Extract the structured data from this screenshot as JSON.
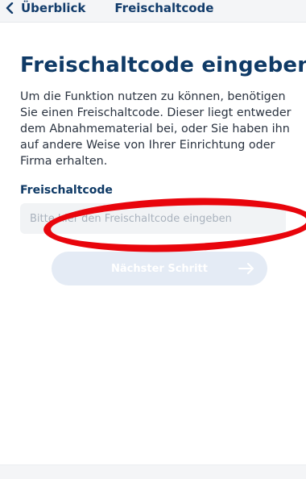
{
  "nav": {
    "back_label": "Überblick",
    "title": "Freischaltcode"
  },
  "main": {
    "title": "Freischaltcode eingeben",
    "description": "Um die Funktion nutzen zu können, benötigen Sie einen Freischaltcode. Dieser liegt entweder dem Abnahmematerial bei, oder Sie haben ihn auf andere Weise von Ihrer Einrichtung oder Firma erhalten.",
    "field_label": "Freischaltcode",
    "input": {
      "value": "",
      "placeholder": "Bitte hier den Freischaltcode eingeben"
    },
    "next_button_label": "Nächster Schritt",
    "next_button_state": "disabled"
  },
  "icons": {
    "back": "chevron-left-icon",
    "next": "arrow-right-icon"
  },
  "colors": {
    "title": "#0f3a66",
    "annotation": "#e8050c",
    "button_disabled": "#e4ebf5"
  }
}
